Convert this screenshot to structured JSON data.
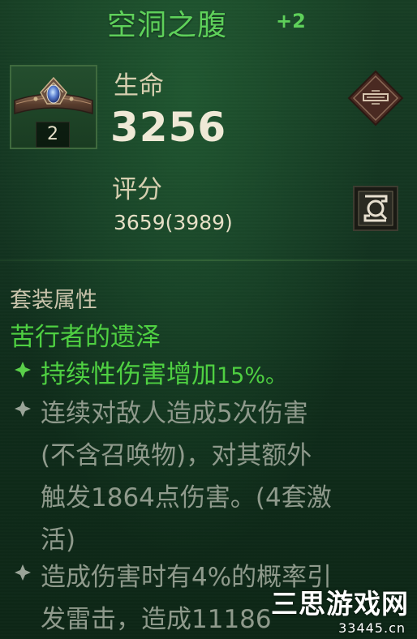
{
  "item": {
    "name": "空洞之腹",
    "level": "+2",
    "count": "2"
  },
  "stats": {
    "life_label": "生命",
    "life_value": "3256",
    "score_label": "评分",
    "score_value": "3659(3989)"
  },
  "icons": {
    "equip": "equip-emblem-icon",
    "compare": "compare-icon",
    "item": "belt-item-icon",
    "bullet": "diamond-bullet-icon"
  },
  "set": {
    "header": "套装属性",
    "name": "苦行者的遗泽",
    "bonuses": [
      {
        "active": true,
        "text": "持续性伤害增加",
        "value": "15%。"
      },
      {
        "active": false,
        "lines": [
          "连续对敌人造成5次伤害",
          "(不含召唤物)，对其额外",
          "触发1864点伤害。(4套激",
          "活)"
        ]
      },
      {
        "active": false,
        "lines": [
          "造成伤害时有4%的概率引",
          "发雷击，造成11186"
        ]
      }
    ]
  },
  "colors": {
    "title_green": "#5ed05a",
    "active_green": "#4fd042",
    "inactive_gray": "#8f9a8c",
    "label_beige": "#d7cfb0"
  },
  "watermark": {
    "cn": "三思游戏网",
    "en": "33445.cn"
  }
}
